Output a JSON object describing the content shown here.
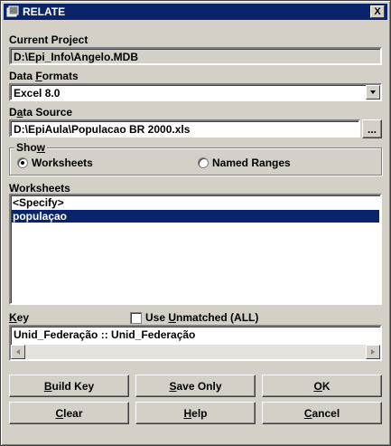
{
  "window": {
    "title": "RELATE",
    "close_label": "X"
  },
  "current_project": {
    "label": "Current Project",
    "value": "D:\\Epi_Info\\Angelo.MDB"
  },
  "data_formats": {
    "label_pre": "Data ",
    "label_u": "F",
    "label_post": "ormats",
    "selected": "Excel 8.0"
  },
  "data_source": {
    "label_pre": "D",
    "label_u": "a",
    "label_post": "ta Source",
    "value": "D:\\EpiAula\\Populacao BR 2000.xls",
    "browse_label": "..."
  },
  "show": {
    "label_pre": "Sho",
    "label_u": "w",
    "label_post": "",
    "option1": "Worksheets",
    "option2": "Named Ranges",
    "selected": "Worksheets"
  },
  "worksheets": {
    "label": "Worksheets",
    "items": [
      "<Specify>",
      "populaçao"
    ],
    "selected_index": 1
  },
  "key": {
    "label_pre": "",
    "label_u": "K",
    "label_post": "ey",
    "value": "Unid_Federação :: Unid_Federação"
  },
  "use_unmatched": {
    "label_pre": "Use ",
    "label_u": "U",
    "label_post": "nmatched (ALL)",
    "checked": false
  },
  "buttons": {
    "build_key": {
      "pre": "",
      "u": "B",
      "post": "uild Key"
    },
    "save_only": {
      "pre": "",
      "u": "S",
      "post": "ave Only"
    },
    "ok": {
      "pre": "",
      "u": "O",
      "post": "K"
    },
    "clear": {
      "pre": "",
      "u": "C",
      "post": "lear"
    },
    "help": {
      "pre": "",
      "u": "H",
      "post": "elp"
    },
    "cancel": {
      "pre": "",
      "u": "C",
      "post": "ancel"
    }
  }
}
